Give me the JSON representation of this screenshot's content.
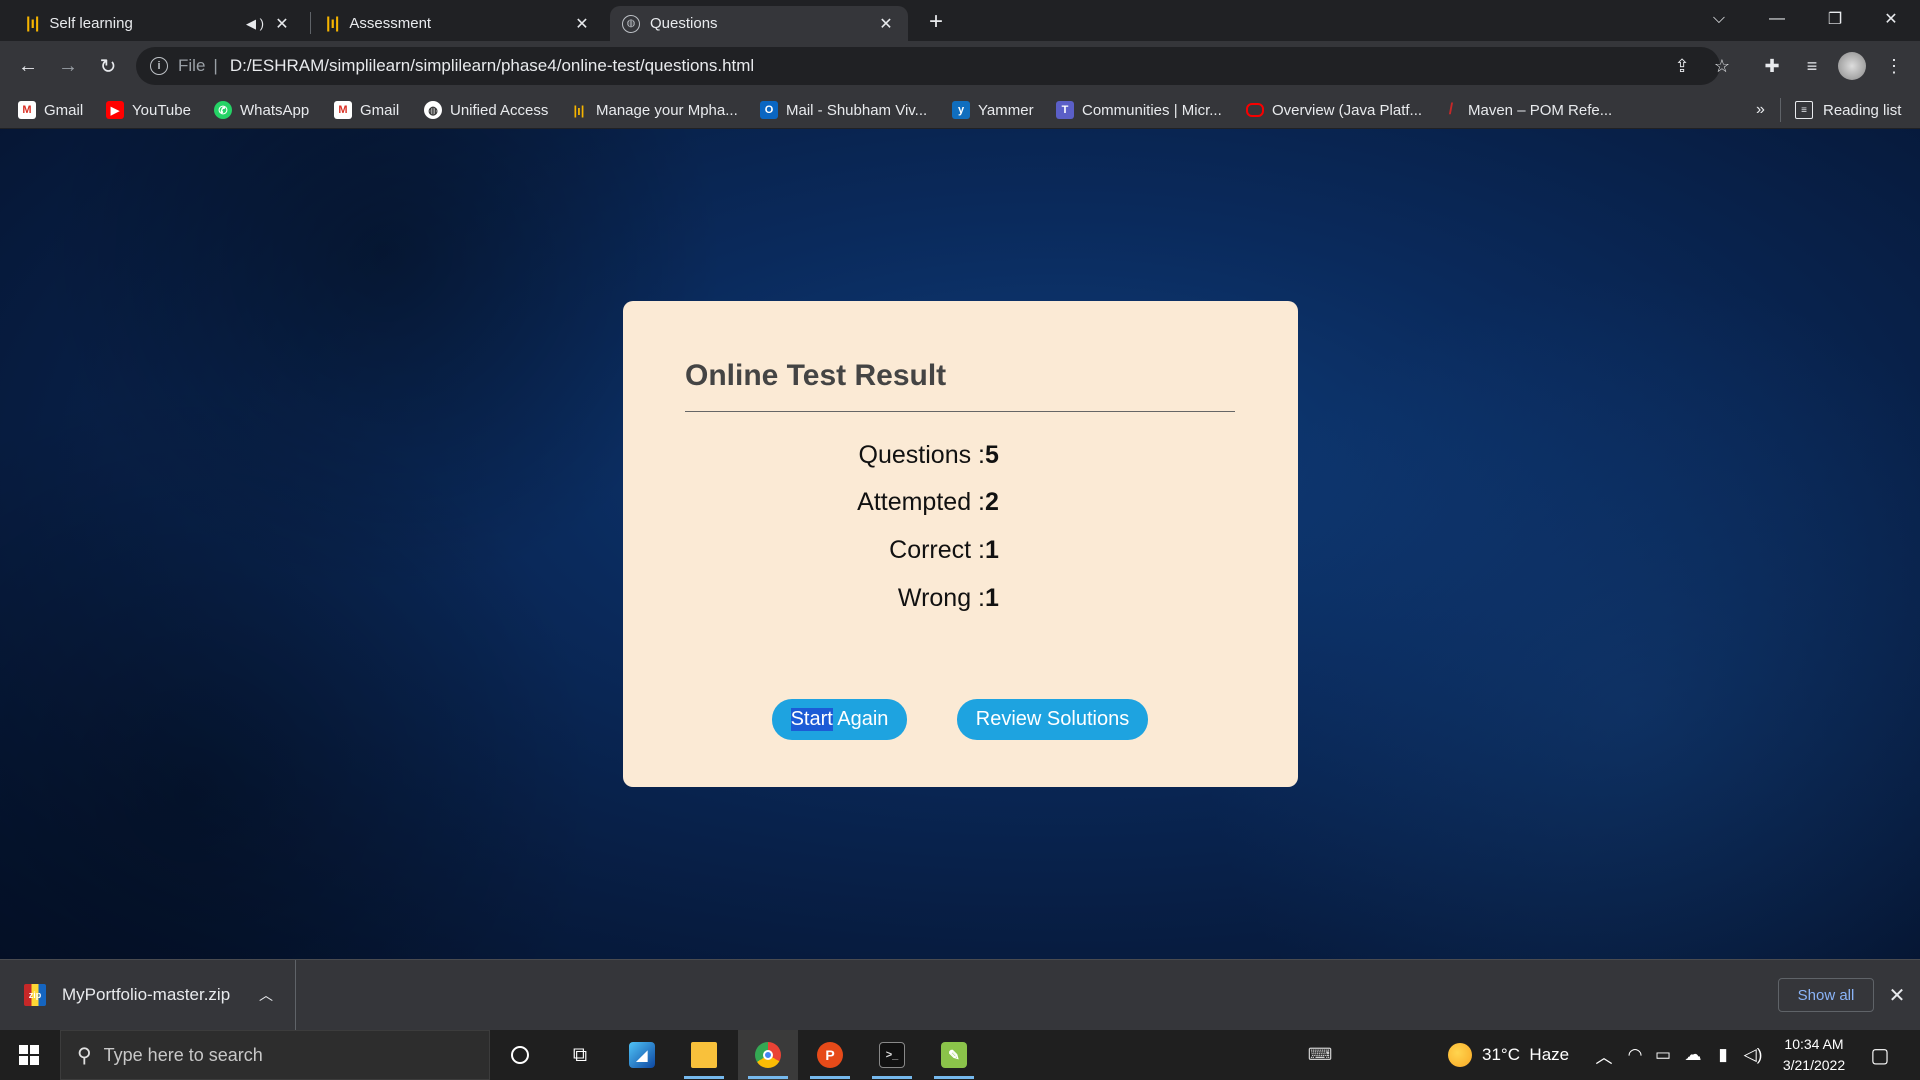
{
  "browser": {
    "tabs": [
      {
        "label": "Self learning"
      },
      {
        "label": "Assessment"
      },
      {
        "label": "Questions"
      }
    ],
    "address": {
      "scheme_label": "File",
      "url": "D:/ESHRAM/simplilearn/simplilearn/phase4/online-test/questions.html"
    },
    "bookmarks": [
      {
        "label": "Gmail"
      },
      {
        "label": "YouTube"
      },
      {
        "label": "WhatsApp"
      },
      {
        "label": "Gmail"
      },
      {
        "label": "Unified Access"
      },
      {
        "label": "Manage your Mpha..."
      },
      {
        "label": "Mail - Shubham Viv..."
      },
      {
        "label": "Yammer"
      },
      {
        "label": "Communities | Micr..."
      },
      {
        "label": "Overview (Java Platf..."
      },
      {
        "label": "Maven – POM Refe..."
      }
    ],
    "more_bookmarks": "»",
    "reading_list": "Reading list"
  },
  "result": {
    "title": "Online Test Result",
    "stats": [
      {
        "label": "Questions :",
        "value": "5"
      },
      {
        "label": "Attempted :",
        "value": "2"
      },
      {
        "label": "Correct :",
        "value": "1"
      },
      {
        "label": "Wrong :",
        "value": "1"
      }
    ],
    "start_again_selected": "Start",
    "start_again_rest": " Again",
    "review_label": "Review Solutions"
  },
  "downloads": {
    "file": "MyPortfolio-master.zip",
    "show_all": "Show all"
  },
  "taskbar": {
    "search_placeholder": "Type here to search",
    "weather": "31°C  Haze",
    "time": "10:34 AM",
    "date": "3/21/2022"
  },
  "colors": {
    "card_bg": "#fbead5",
    "button_bg": "#1ea3e0",
    "chrome_dark": "#202124",
    "chrome_toolbar": "#35363a"
  }
}
